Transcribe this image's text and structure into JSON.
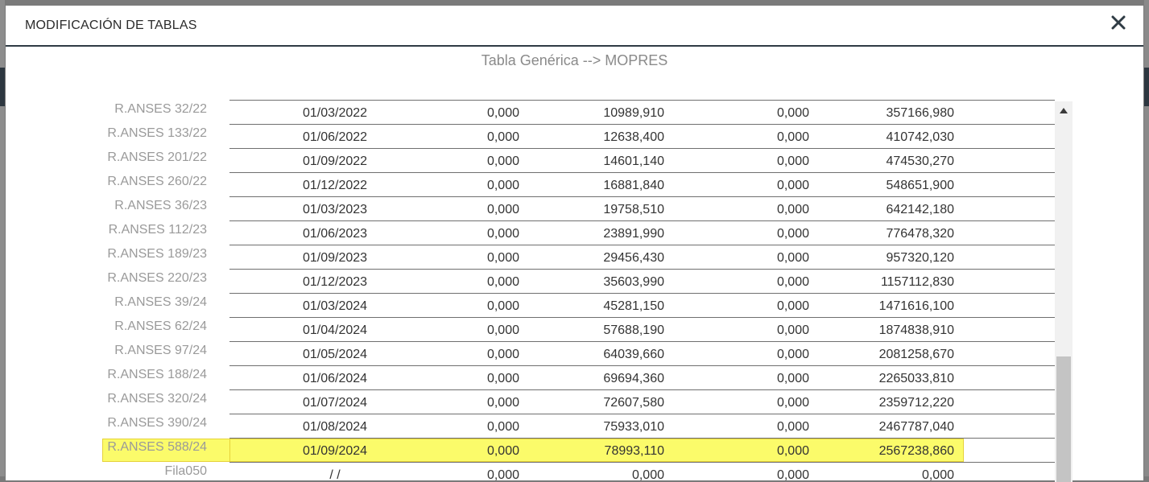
{
  "modal": {
    "title": "MODIFICACIÓN DE TABLAS",
    "subtitle": "Tabla Genérica --> MOPRES"
  },
  "highlight_color": "#fbfb6a",
  "rows": [
    {
      "label": "R.ANSES 32/22",
      "date": "01/03/2022",
      "v1": "0,000",
      "v2": "10989,910",
      "v3": "0,000",
      "v4": "357166,980",
      "highlighted": false
    },
    {
      "label": "R.ANSES 133/22",
      "date": "01/06/2022",
      "v1": "0,000",
      "v2": "12638,400",
      "v3": "0,000",
      "v4": "410742,030",
      "highlighted": false
    },
    {
      "label": "R.ANSES 201/22",
      "date": "01/09/2022",
      "v1": "0,000",
      "v2": "14601,140",
      "v3": "0,000",
      "v4": "474530,270",
      "highlighted": false
    },
    {
      "label": "R.ANSES 260/22",
      "date": "01/12/2022",
      "v1": "0,000",
      "v2": "16881,840",
      "v3": "0,000",
      "v4": "548651,900",
      "highlighted": false
    },
    {
      "label": "R.ANSES 36/23",
      "date": "01/03/2023",
      "v1": "0,000",
      "v2": "19758,510",
      "v3": "0,000",
      "v4": "642142,180",
      "highlighted": false
    },
    {
      "label": "R.ANSES 112/23",
      "date": "01/06/2023",
      "v1": "0,000",
      "v2": "23891,990",
      "v3": "0,000",
      "v4": "776478,320",
      "highlighted": false
    },
    {
      "label": "R.ANSES 189/23",
      "date": "01/09/2023",
      "v1": "0,000",
      "v2": "29456,430",
      "v3": "0,000",
      "v4": "957320,120",
      "highlighted": false
    },
    {
      "label": "R.ANSES 220/23",
      "date": "01/12/2023",
      "v1": "0,000",
      "v2": "35603,990",
      "v3": "0,000",
      "v4": "1157112,830",
      "highlighted": false
    },
    {
      "label": "R.ANSES 39/24",
      "date": "01/03/2024",
      "v1": "0,000",
      "v2": "45281,150",
      "v3": "0,000",
      "v4": "1471616,100",
      "highlighted": false
    },
    {
      "label": "R.ANSES 62/24",
      "date": "01/04/2024",
      "v1": "0,000",
      "v2": "57688,190",
      "v3": "0,000",
      "v4": "1874838,910",
      "highlighted": false
    },
    {
      "label": "R.ANSES 97/24",
      "date": "01/05/2024",
      "v1": "0,000",
      "v2": "64039,660",
      "v3": "0,000",
      "v4": "2081258,670",
      "highlighted": false
    },
    {
      "label": "R.ANSES 188/24",
      "date": "01/06/2024",
      "v1": "0,000",
      "v2": "69694,360",
      "v3": "0,000",
      "v4": "2265033,810",
      "highlighted": false
    },
    {
      "label": "R.ANSES 320/24",
      "date": "01/07/2024",
      "v1": "0,000",
      "v2": "72607,580",
      "v3": "0,000",
      "v4": "2359712,220",
      "highlighted": false
    },
    {
      "label": "R.ANSES 390/24",
      "date": "01/08/2024",
      "v1": "0,000",
      "v2": "75933,010",
      "v3": "0,000",
      "v4": "2467787,040",
      "highlighted": false
    },
    {
      "label": "R.ANSES 588/24",
      "date": "01/09/2024",
      "v1": "0,000",
      "v2": "78993,110",
      "v3": "0,000",
      "v4": "2567238,860",
      "highlighted": true
    },
    {
      "label": "Fila050",
      "date": "/ /",
      "v1": "0,000",
      "v2": "0,000",
      "v3": "0,000",
      "v4": "0,000",
      "highlighted": false
    }
  ],
  "icons": {
    "close": "close-icon",
    "scroll_up": "scroll-up-arrow-icon"
  }
}
